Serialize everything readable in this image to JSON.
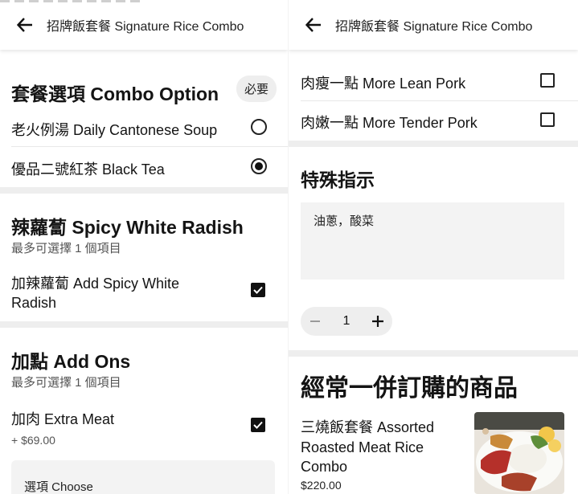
{
  "header": {
    "title": "招牌飯套餐 Signature Rice Combo"
  },
  "left": {
    "combo": {
      "title": "套餐選項 Combo Option",
      "badge": "必要",
      "options": [
        {
          "label": "老火例湯 Daily Cantonese Soup",
          "selected": false
        },
        {
          "label": "優品二號紅茶 Black Tea",
          "selected": true
        }
      ]
    },
    "radish": {
      "title": "辣蘿蔔 Spicy White Radish",
      "subtitle": "最多可選擇 1 個項目",
      "option_line1": "加辣蘿蔔 Add Spicy White",
      "option_line2": "Radish",
      "checked": true
    },
    "addons": {
      "title": "加點 Add Ons",
      "subtitle": "最多可選擇 1 個項目",
      "option": "加肉 Extra Meat",
      "price": "+ $69.00",
      "checked": true,
      "choose_label": "選項 Choose"
    }
  },
  "right": {
    "pork_options": [
      {
        "label": "肉瘦一點 More Lean Pork",
        "checked": false
      },
      {
        "label": "肉嫩一點 More Tender Pork",
        "checked": false
      }
    ],
    "instructions": {
      "title": "特殊指示",
      "value": "油蔥，酸菜"
    },
    "quantity": {
      "value": "1"
    },
    "frequently": {
      "title": "經常一併訂購的商品",
      "item_line1": "三燒飯套餐 Assorted",
      "item_line2": "Roasted Meat Rice",
      "item_line3": "Combo",
      "item_price": "$220.00"
    }
  },
  "icons": {
    "back": "arrow-left-icon",
    "minus": "minus-icon",
    "plus": "plus-icon",
    "check": "check-icon"
  },
  "colors": {
    "primary": "#141414",
    "muted": "#545454",
    "surface": "#eeeeee"
  }
}
